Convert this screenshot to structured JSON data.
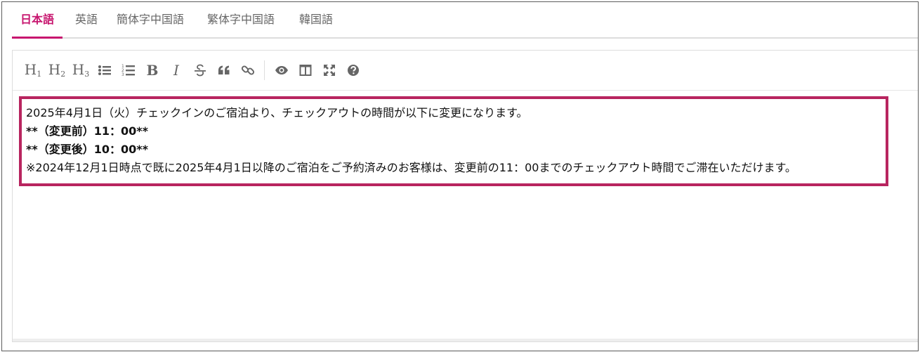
{
  "tabs": [
    {
      "label": "日本語",
      "active": true
    },
    {
      "label": "英語",
      "active": false
    },
    {
      "label": "簡体字中国語",
      "active": false
    },
    {
      "label": "繁体字中国語",
      "active": false
    },
    {
      "label": "韓国語",
      "active": false
    }
  ],
  "toolbar": {
    "h1": "H",
    "h1_sub": "1",
    "h2": "H",
    "h2_sub": "2",
    "h3": "H",
    "h3_sub": "3",
    "bold": "B",
    "italic": "I",
    "icons": [
      "heading-1-icon",
      "heading-2-icon",
      "heading-3-icon",
      "unordered-list-icon",
      "ordered-list-icon",
      "bold-icon",
      "italic-icon",
      "strikethrough-icon",
      "quote-icon",
      "link-icon",
      "preview-eye-icon",
      "side-by-side-icon",
      "fullscreen-icon",
      "help-icon"
    ]
  },
  "editor": {
    "lines": [
      "2025年4月1日（火）チェックインのご宿泊より、チェックアウトの時間が以下に変更になります。",
      "**（変更前）11：00**",
      "**（変更後）10：00**",
      "※2024年12月1日時点で既に2025年4月1日以降のご宿泊をご予約済みのお客様は、変更前の11：00までのチェックアウト時間でご滞在いただけます。"
    ]
  },
  "colors": {
    "accent": "#c7166f",
    "highlight_border": "#b8255f",
    "toolbar_icon": "#666666"
  }
}
